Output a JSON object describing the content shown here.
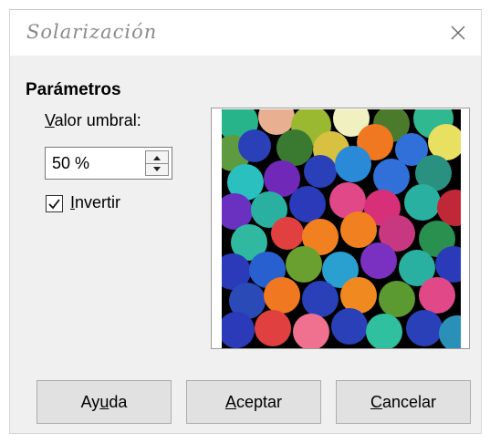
{
  "window": {
    "title": "Solarización",
    "close_icon": "close-icon"
  },
  "parameters": {
    "heading": "Parámetros",
    "threshold": {
      "label_mnemonic": "V",
      "label_rest": "alor umbral:",
      "value": "50 %",
      "spin_up_icon": "arrow-up-icon",
      "spin_down_icon": "arrow-down-icon"
    },
    "invert": {
      "label_mnemonic": "I",
      "label_rest": "nvertir",
      "checked": true
    }
  },
  "preview": {
    "icon": "solarized-preview-image"
  },
  "buttons": {
    "help": {
      "before": "Ay",
      "mnemonic": "u",
      "after": "da"
    },
    "ok": {
      "before": "",
      "mnemonic": "A",
      "after": "ceptar"
    },
    "cancel": {
      "before": "",
      "mnemonic": "C",
      "after": "ancelar"
    }
  },
  "colors": {
    "dialog_bg": "#f0f0f0",
    "title_text": "#8a8a8a",
    "button_bg": "#e1e1e1",
    "button_border": "#adadad"
  }
}
